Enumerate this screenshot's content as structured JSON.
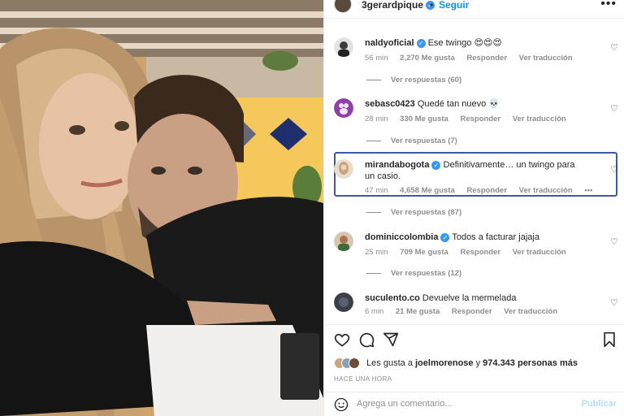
{
  "post": {
    "username": "3gerardpique",
    "follow_label": "Seguir",
    "dot": "•",
    "more": "•••"
  },
  "comments": [
    {
      "username": "naldyoficial",
      "verified": true,
      "text": "Ese twingo 😍😍😍",
      "time": "56 min",
      "likes": "2,270 Me gusta",
      "reply": "Responder",
      "translate": "Ver traducción",
      "replies": "Ver respuestas (60)"
    },
    {
      "username": "sebasc0423",
      "verified": false,
      "text": "Quedé tan nuevo 💀",
      "time": "28 min",
      "likes": "330 Me gusta",
      "reply": "Responder",
      "translate": "Ver traducción",
      "replies": "Ver respuestas (7)"
    },
    {
      "username": "mirandabogota",
      "verified": true,
      "text": "Definitivamente… un twingo para un casio.",
      "time": "47 min",
      "likes": "4,658 Me gusta",
      "reply": "Responder",
      "translate": "Ver traducción",
      "more": "•••",
      "replies": "Ver respuestas (87)"
    },
    {
      "username": "dominiccolombia",
      "verified": true,
      "text": "Todos a facturar jajaja",
      "time": "25 min",
      "likes": "709 Me gusta",
      "reply": "Responder",
      "translate": "Ver traducción",
      "replies": "Ver respuestas (12)"
    },
    {
      "username": "suculento.co",
      "verified": false,
      "text": "Devuelve la mermelada",
      "time": "6 min",
      "likes": "21 Me gusta",
      "reply": "Responder",
      "translate": "Ver traducción"
    }
  ],
  "likes": {
    "prefix": "Les gusta a",
    "user": "joelmorenose",
    "middle": "y",
    "count": "974.343 personas más"
  },
  "timestamp": "HACE UNA HORA",
  "composer": {
    "placeholder": "Agrega un comentario...",
    "post_label": "Publicar"
  },
  "colors": {
    "link_blue": "#0095f6",
    "verified_blue": "#3897f0",
    "muted": "#8e8e8e",
    "highlight_border": "#3a5ba0"
  }
}
